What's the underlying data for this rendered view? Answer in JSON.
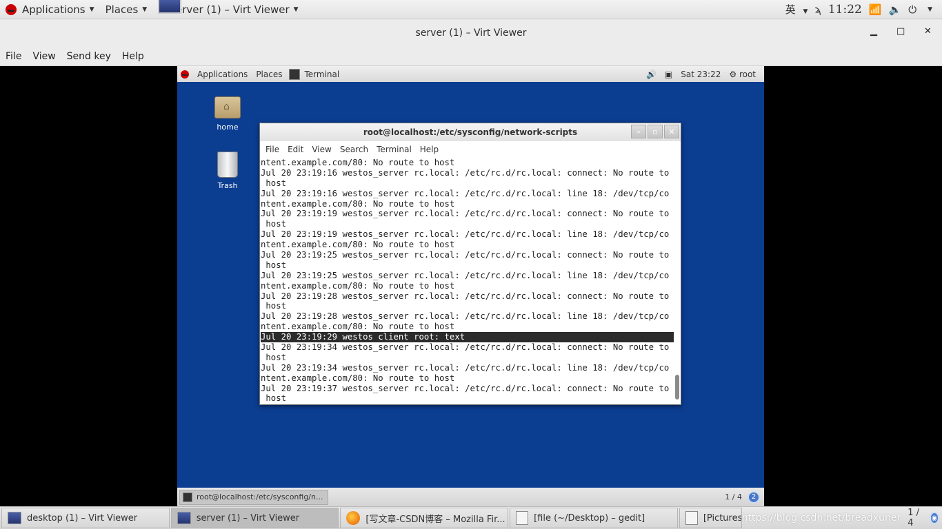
{
  "host_panel": {
    "applications": "Applications",
    "places": "Places",
    "active_window": "server (1) – Virt Viewer",
    "ime": "英",
    "clock": "11:22"
  },
  "viewer": {
    "title": "server (1) – Virt Viewer",
    "menu": [
      "File",
      "View",
      "Send key",
      "Help"
    ]
  },
  "guest_panel": {
    "applications": "Applications",
    "places": "Places",
    "terminal": "Terminal",
    "clock": "Sat 23:22",
    "user": "root"
  },
  "desktop_icons": [
    "home",
    "Trash"
  ],
  "terminal": {
    "title": "root@localhost:/etc/sysconfig/network-scripts",
    "menu": [
      "File",
      "Edit",
      "View",
      "Search",
      "Terminal",
      "Help"
    ],
    "lines": [
      "ntent.example.com/80: No route to host",
      "Jul 20 23:19:16 westos_server rc.local: /etc/rc.d/rc.local: connect: No route to",
      " host",
      "Jul 20 23:19:16 westos_server rc.local: /etc/rc.d/rc.local: line 18: /dev/tcp/co",
      "ntent.example.com/80: No route to host",
      "Jul 20 23:19:19 westos_server rc.local: /etc/rc.d/rc.local: connect: No route to",
      " host",
      "Jul 20 23:19:19 westos_server rc.local: /etc/rc.d/rc.local: line 18: /dev/tcp/co",
      "ntent.example.com/80: No route to host",
      "Jul 20 23:19:25 westos_server rc.local: /etc/rc.d/rc.local: connect: No route to",
      " host",
      "Jul 20 23:19:25 westos_server rc.local: /etc/rc.d/rc.local: line 18: /dev/tcp/co",
      "ntent.example.com/80: No route to host",
      "Jul 20 23:19:28 westos_server rc.local: /etc/rc.d/rc.local: connect: No route to",
      " host",
      "Jul 20 23:19:28 westos_server rc.local: /etc/rc.d/rc.local: line 18: /dev/tcp/co",
      "ntent.example.com/80: No route to host",
      "Jul 20 23:19:29 westos client root: text",
      "Jul 20 23:19:34 westos_server rc.local: /etc/rc.d/rc.local: connect: No route to",
      " host",
      "Jul 20 23:19:34 westos_server rc.local: /etc/rc.d/rc.local: line 18: /dev/tcp/co",
      "ntent.example.com/80: No route to host",
      "Jul 20 23:19:37 westos_server rc.local: /etc/rc.d/rc.local: connect: No route to",
      " host"
    ],
    "highlighted_line": 17
  },
  "guest_taskbar": {
    "task": "root@localhost:/etc/sysconfig/n...",
    "workspace": "1 / 4",
    "badge": "2"
  },
  "host_taskbar": {
    "tasks": [
      "desktop (1) – Virt Viewer",
      "server (1) – Virt Viewer",
      "[写文章-CSDN博客 – Mozilla Fir...",
      "[file (~/Desktop) – gedit]",
      "[Pictures]"
    ],
    "workspace": "1 / 4",
    "watermark": "https://blog.csdn.net/breadxuner"
  }
}
